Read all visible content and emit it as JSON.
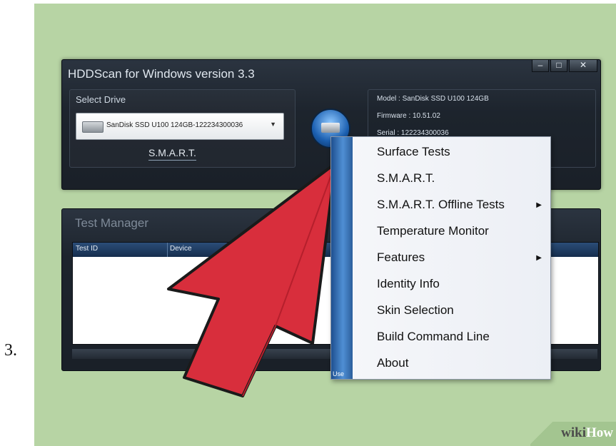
{
  "step_number": "3.",
  "main_window": {
    "title": "HDDScan for Windows version 3.3",
    "controls": [
      "–",
      "□",
      "✕"
    ],
    "select_drive_label": "Select Drive",
    "selected_drive": "SanDisk SSD U100 124GB-122234300036",
    "smart_button": "S.M.A.R.T.",
    "drive_info": {
      "model": "Model : SanDisk SSD U100 124GB",
      "firmware": "Firmware : 10.51.02",
      "serial": "Serial : 122234300036"
    }
  },
  "test_manager": {
    "title": "Test Manager",
    "columns": [
      "Test ID",
      "Device"
    ]
  },
  "context_menu": {
    "side_text": "Use",
    "items": [
      {
        "label": "Surface Tests",
        "submenu": ""
      },
      {
        "label": "S.M.A.R.T.",
        "submenu": ""
      },
      {
        "label": "S.M.A.R.T. Offline Tests",
        "submenu": "▶"
      },
      {
        "label": "Temperature Monitor",
        "submenu": ""
      },
      {
        "label": "Features",
        "submenu": "▶"
      },
      {
        "label": "Identity Info",
        "submenu": ""
      },
      {
        "label": "Skin Selection",
        "submenu": ""
      },
      {
        "label": "Build Command Line",
        "submenu": ""
      },
      {
        "label": "About",
        "submenu": ""
      }
    ]
  },
  "watermark": {
    "wiki": "wiki",
    "how": "How"
  },
  "colors": {
    "background": "#b7d4a4",
    "arrow": "#d82e3c",
    "window": "#1d242d",
    "menu_strip": "#2b6bb5"
  }
}
